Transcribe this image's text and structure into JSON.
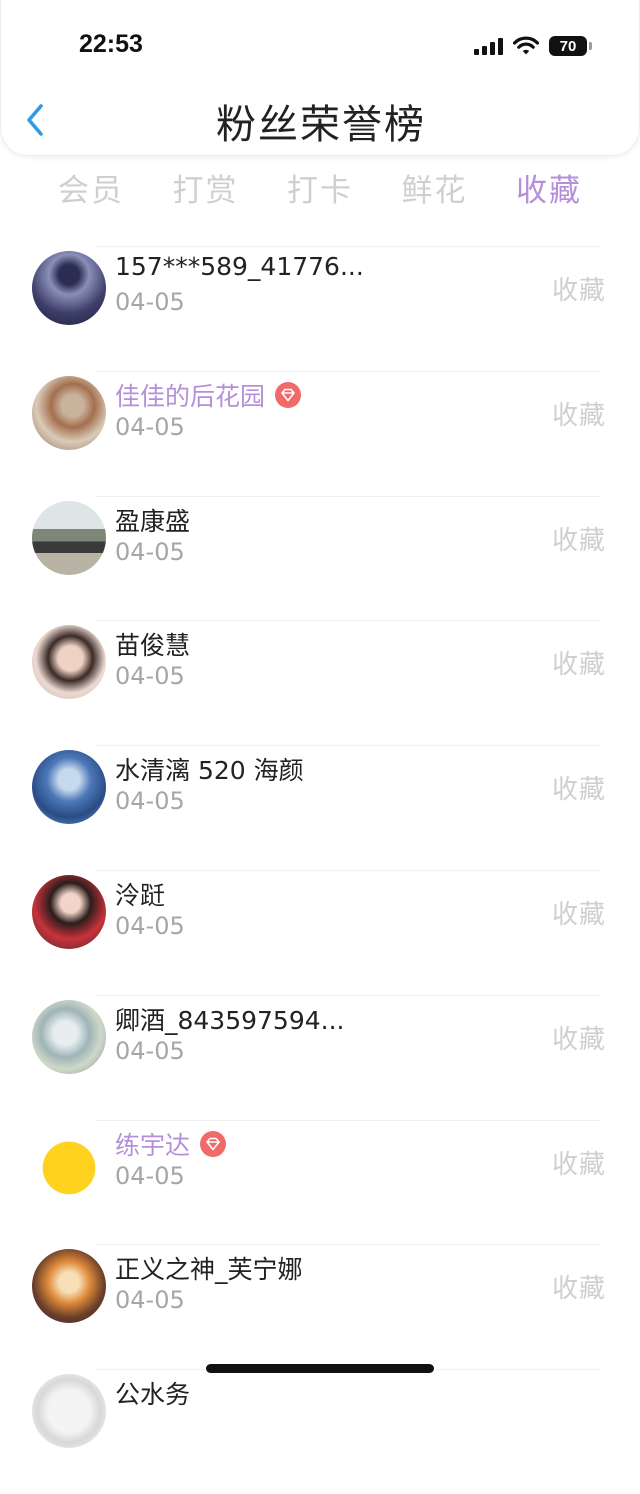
{
  "status_bar": {
    "time": "22:53",
    "battery": "70"
  },
  "header": {
    "title": "粉丝荣誉榜"
  },
  "tabs": [
    {
      "label": "会员",
      "active": false
    },
    {
      "label": "打赏",
      "active": false
    },
    {
      "label": "打卡",
      "active": false
    },
    {
      "label": "鲜花",
      "active": false
    },
    {
      "label": "收藏",
      "active": true
    }
  ],
  "fans": [
    {
      "name": "157***589_41776...",
      "date": "04-05",
      "action": "收藏",
      "vip": false
    },
    {
      "name": "佳佳的后花园",
      "date": "04-05",
      "action": "收藏",
      "vip": true
    },
    {
      "name": "盈康盛",
      "date": "04-05",
      "action": "收藏",
      "vip": false
    },
    {
      "name": "苗俊慧",
      "date": "04-05",
      "action": "收藏",
      "vip": false
    },
    {
      "name": "水清漓 520 海颜",
      "date": "04-05",
      "action": "收藏",
      "vip": false
    },
    {
      "name": "泠跹",
      "date": "04-05",
      "action": "收藏",
      "vip": false
    },
    {
      "name": "卿酒_843597594...",
      "date": "04-05",
      "action": "收藏",
      "vip": false
    },
    {
      "name": "练宇达",
      "date": "04-05",
      "action": "收藏",
      "vip": true
    },
    {
      "name": "正义之神_芙宁娜",
      "date": "04-05",
      "action": "收藏",
      "vip": false
    },
    {
      "name": "公水务",
      "date": "",
      "action": "",
      "vip": false
    }
  ],
  "colors": {
    "accent": "#b58fd8",
    "back_arrow": "#2f9be8",
    "vip_badge": "#f06a6a"
  }
}
